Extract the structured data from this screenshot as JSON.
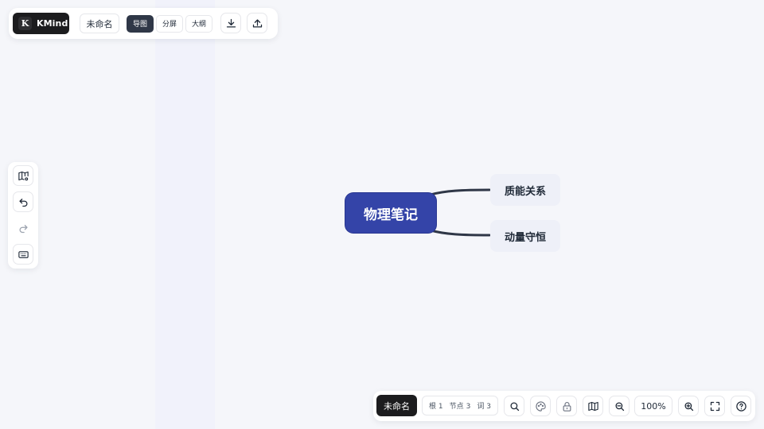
{
  "app": {
    "brand_initial": "K",
    "brand_name": "KMind",
    "doc_title": "未命名"
  },
  "view_modes": [
    {
      "label": "导图",
      "active": true
    },
    {
      "label": "分屏",
      "active": false
    },
    {
      "label": "大纲",
      "active": false
    }
  ],
  "top_actions": [
    "download-icon",
    "upload-icon"
  ],
  "left_tools": [
    "map-settings-icon",
    "undo-icon",
    "redo-icon",
    "keyboard-icon"
  ],
  "mindmap": {
    "root": "物理笔记",
    "children": [
      "质能关系",
      "动量守恒"
    ]
  },
  "bottom": {
    "doc_title": "未命名",
    "stats": {
      "root_label": "根",
      "root_count": "1",
      "nodes_label": "节点",
      "nodes_count": "3",
      "words_label": "词",
      "words_count": "3"
    },
    "zoom": "100%",
    "tools": [
      "search-icon",
      "theme-icon",
      "lock-icon",
      "minimap-icon",
      "zoom-out-icon",
      "zoom-in-icon",
      "fullscreen-icon",
      "help-icon"
    ]
  },
  "colors": {
    "root_fill": "#3444a8",
    "child_fill": "#eef0f8",
    "connector": "#2f3747",
    "active_segment": "#2f3747",
    "brand_bg": "#1c1c1e"
  }
}
